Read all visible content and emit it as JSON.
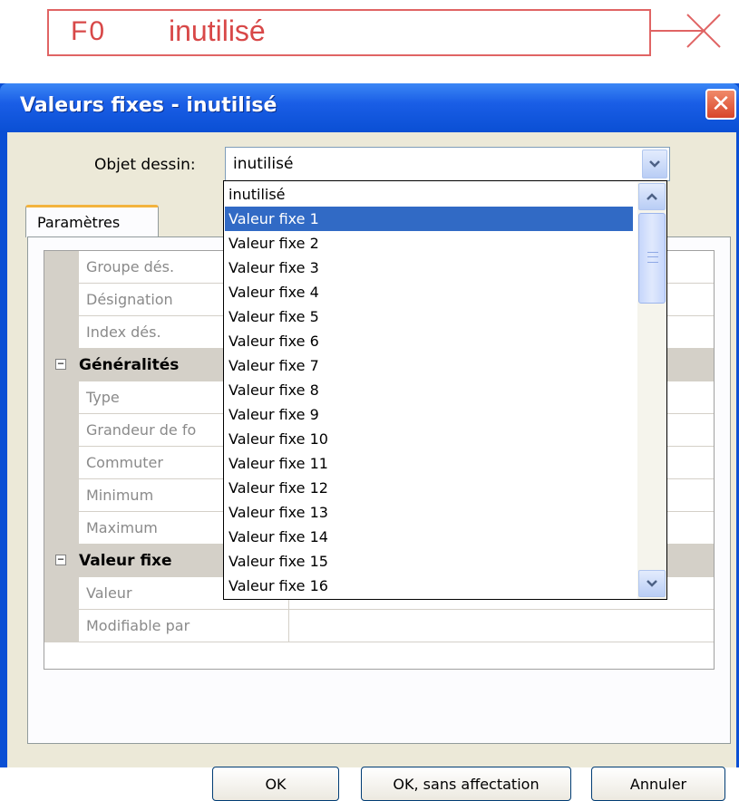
{
  "function_block": {
    "code": "F0",
    "name": "inutilisé"
  },
  "window": {
    "title": "Valeurs fixes - inutilisé",
    "close_glyph": "✕"
  },
  "combo": {
    "label": "Objet dessin:",
    "value": "inutilisé"
  },
  "tab": {
    "label": "Paramètres"
  },
  "properties": {
    "rows": [
      {
        "name": "Groupe dés."
      },
      {
        "name": "Désignation"
      },
      {
        "name": "Index dés."
      }
    ],
    "cat_general": {
      "label": "Généralités",
      "expander": "−"
    },
    "general_rows": [
      {
        "name": "Type"
      },
      {
        "name": "Grandeur de fo"
      },
      {
        "name": "Commuter"
      },
      {
        "name": "Minimum"
      },
      {
        "name": "Maximum"
      }
    ],
    "cat_value": {
      "label": "Valeur fixe",
      "expander": "−"
    },
    "value_rows": [
      {
        "name": "Valeur"
      },
      {
        "name": "Modifiable par"
      }
    ]
  },
  "dropdown": {
    "items": [
      "inutilisé",
      "Valeur fixe 1",
      "Valeur fixe 2",
      "Valeur fixe 3",
      "Valeur fixe 4",
      "Valeur fixe 5",
      "Valeur fixe 6",
      "Valeur fixe 7",
      "Valeur fixe 8",
      "Valeur fixe 9",
      "Valeur fixe 10",
      "Valeur fixe 11",
      "Valeur fixe 12",
      "Valeur fixe 13",
      "Valeur fixe 14",
      "Valeur fixe 15",
      "Valeur fixe 16"
    ],
    "selected": "Valeur fixe 1"
  },
  "buttons": {
    "ok": "OK",
    "ok_no_assign": "OK, sans affectation",
    "cancel": "Annuler"
  },
  "colors": {
    "accent_red": "#d84848",
    "title_blue": "#0a4fd4",
    "selection": "#316ac5"
  }
}
